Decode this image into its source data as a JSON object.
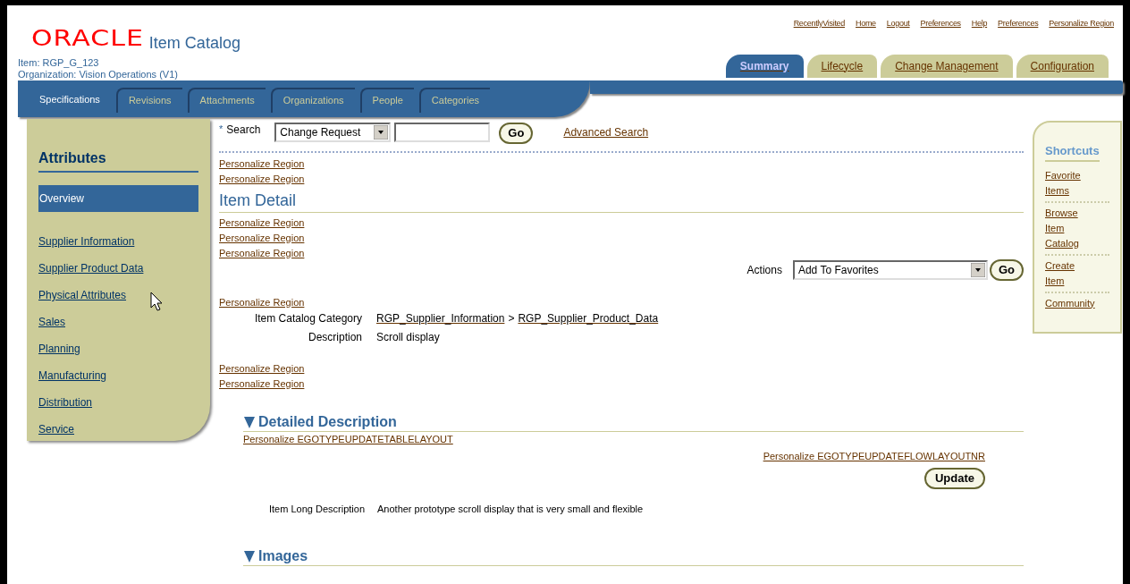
{
  "header": {
    "logo": "ORACLE",
    "app_title": "Item Catalog",
    "item_line": "Item: RGP_G_123",
    "org_line": "Organization: Vision Operations (V1)",
    "global_links": [
      "RecentlyVisited",
      "Home",
      "Logout",
      "Preferences",
      "Help",
      "Preferences",
      "Personalize Region"
    ],
    "tabs": [
      {
        "label": "Summary",
        "selected": true
      },
      {
        "label": "Lifecycle",
        "selected": false
      },
      {
        "label": "Change Management",
        "selected": false
      },
      {
        "label": "Configuration",
        "selected": false
      }
    ],
    "subtabs": [
      {
        "label": "Specifications",
        "selected": true
      },
      {
        "label": "Revisions",
        "selected": false
      },
      {
        "label": "Attachments",
        "selected": false
      },
      {
        "label": "Organizations",
        "selected": false
      },
      {
        "label": "People",
        "selected": false
      },
      {
        "label": "Categories",
        "selected": false
      }
    ]
  },
  "sidebar": {
    "title": "Attributes",
    "items": [
      {
        "label": "Overview",
        "selected": true
      },
      {
        "label": "Supplier Information",
        "selected": false
      },
      {
        "label": "Supplier Product Data",
        "selected": false
      },
      {
        "label": "Physical Attributes",
        "selected": false
      },
      {
        "label": "Sales",
        "selected": false
      },
      {
        "label": "Planning",
        "selected": false
      },
      {
        "label": "Manufacturing",
        "selected": false
      },
      {
        "label": "Distribution",
        "selected": false
      },
      {
        "label": "Service",
        "selected": false
      }
    ]
  },
  "search": {
    "required_mark": "*",
    "label": "Search",
    "select": "Change Request",
    "button": "Go",
    "advanced": "Advanced Search"
  },
  "links_top": [
    "Personalize Region",
    "Personalize Region"
  ],
  "section_title": "Item Detail",
  "links_mid": [
    "Personalize Region",
    "Personalize Region",
    "Personalize Region"
  ],
  "actions": {
    "label": "Actions",
    "select": "Add To Favorites",
    "button": "Go"
  },
  "links_before_fields": [
    "Personalize Region"
  ],
  "fields": [
    {
      "label": "Item Catalog Category",
      "kind": "links",
      "values": [
        "RGP_Supplier_Information",
        "RGP_Supplier_Product_Data"
      ],
      "separator": ">"
    },
    {
      "label": "Description",
      "kind": "text",
      "values": [
        "Scroll display"
      ]
    }
  ],
  "links_after": [
    "Personalize Region",
    "Personalize Region"
  ],
  "sections": [
    {
      "title": "Detailed Description",
      "expanded": true,
      "link_left": "Personalize EGOTYPEUPDATETABLELAYOUT",
      "link_right": "Personalize EGOTYPEUPDATEFLOWLAYOUTNR",
      "button": "Update",
      "field_label": "Item Long Description",
      "field_value": "Another prototype scroll display that is very small and flexible"
    },
    {
      "title": "Images",
      "expanded": true
    }
  ],
  "shortcuts": {
    "title": "Shortcuts",
    "items": [
      "Favorite Items",
      "Browse Item Catalog",
      "Create Item",
      "Community"
    ]
  }
}
